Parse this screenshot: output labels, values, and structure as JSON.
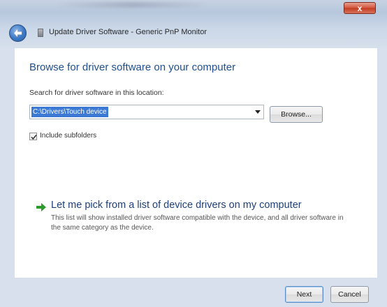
{
  "window": {
    "title": "Update Driver Software - Generic PnP Monitor",
    "close_label": "x"
  },
  "page": {
    "heading": "Browse for driver software on your computer",
    "search_label": "Search for driver software in this location:",
    "path_value": "C:\\Drivers\\Touch device",
    "browse_label": "Browse...",
    "include_subfolders_label": "Include subfolders",
    "include_subfolders_checked": true,
    "pick_link": "Let me pick from a list of device drivers on my computer",
    "pick_description": "This list will show installed driver software compatible with the device, and all driver software in the same category as the device."
  },
  "footer": {
    "next_label": "Next",
    "cancel_label": "Cancel"
  },
  "icons": {
    "back": "back-arrow-icon",
    "pick_arrow": "green-arrow-icon",
    "checkbox": "checkmark-icon",
    "wizard": "device-icon"
  },
  "colors": {
    "heading": "#1f4f8f",
    "selection": "#3b79d4",
    "arrow": "#2e9a2e"
  }
}
